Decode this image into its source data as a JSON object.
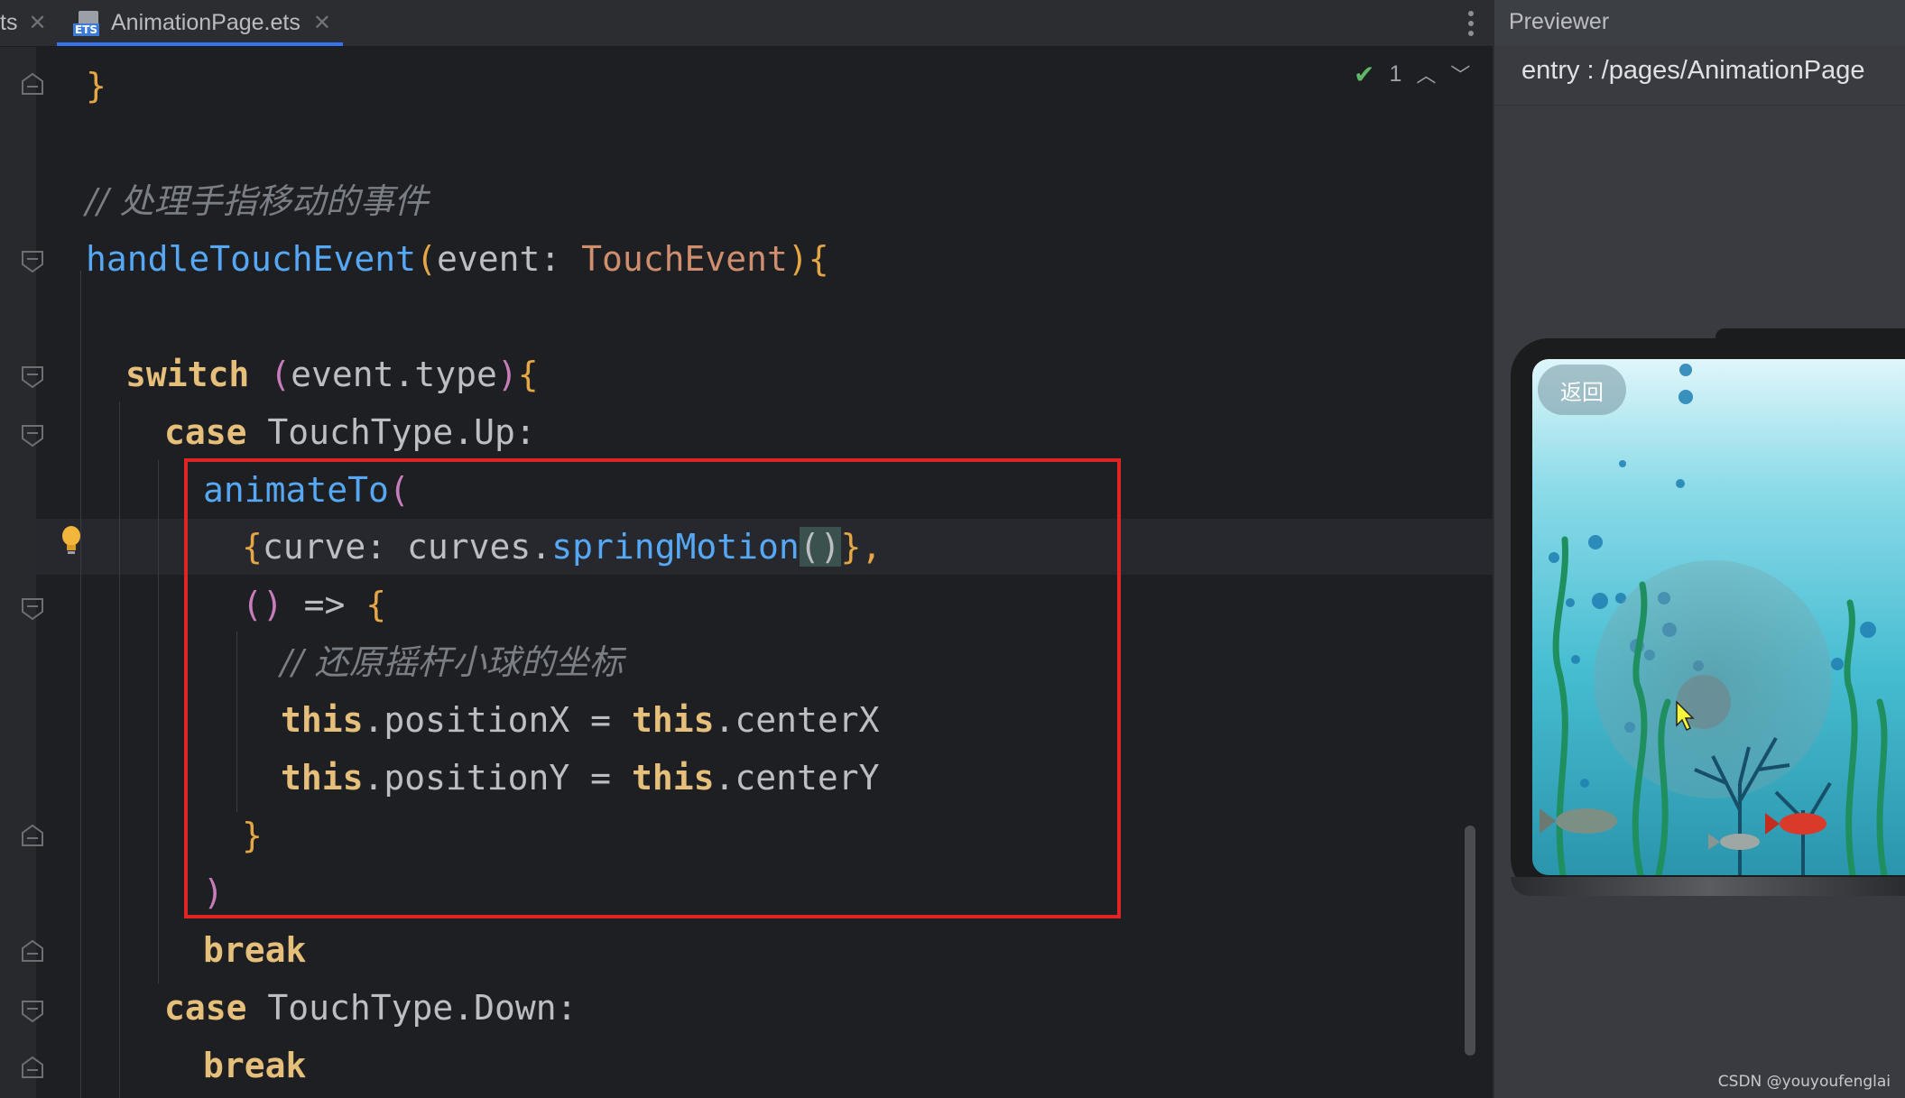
{
  "editor": {
    "tabs": [
      {
        "label": "ts",
        "state": "inactive"
      },
      {
        "label": "AnimationPage.ets",
        "state": "active",
        "icon": "ets-file-icon"
      }
    ],
    "inspection": {
      "count": "1"
    },
    "code": {
      "close_brace": "}",
      "comment_touch": "// 处理手指移动的事件",
      "fn_name": "handleTouchEvent",
      "fn_paren_open": "(",
      "fn_param": "event: ",
      "fn_param_type": "TouchEvent",
      "fn_paren_close": ")",
      "open_brace": "{",
      "switch_kw": "switch",
      "switch_expr": "event.type",
      "case_kw": "case",
      "case_up": " TouchType.Up:",
      "animate_fn": "animateTo",
      "curve_open": "{",
      "curve_key": "curve: curves.",
      "curve_fn": "springMotion",
      "curve_parens": "()",
      "curve_close": "},",
      "arrow_parens": "()",
      "arrow": " => ",
      "comment_reset": "// 还原摇杆小球的坐标",
      "this_kw": "this",
      "assign_x": ".positionX = ",
      "center_x": ".centerX",
      "assign_y": ".positionY = ",
      "center_y": ".centerY",
      "close_paren": ")",
      "break_kw": "break",
      "case_down": " TouchType.Down:"
    }
  },
  "previewer": {
    "title": "Previewer",
    "path": "entry : /pages/AnimationPage",
    "back_button": "返回"
  },
  "watermark": "CSDN @youyoufenglai",
  "colors": {
    "keyword": "#e6c07b",
    "function": "#56a8f5",
    "type": "#cf8e6d",
    "comment": "#7a7e85",
    "highlight_box": "#e02424"
  }
}
